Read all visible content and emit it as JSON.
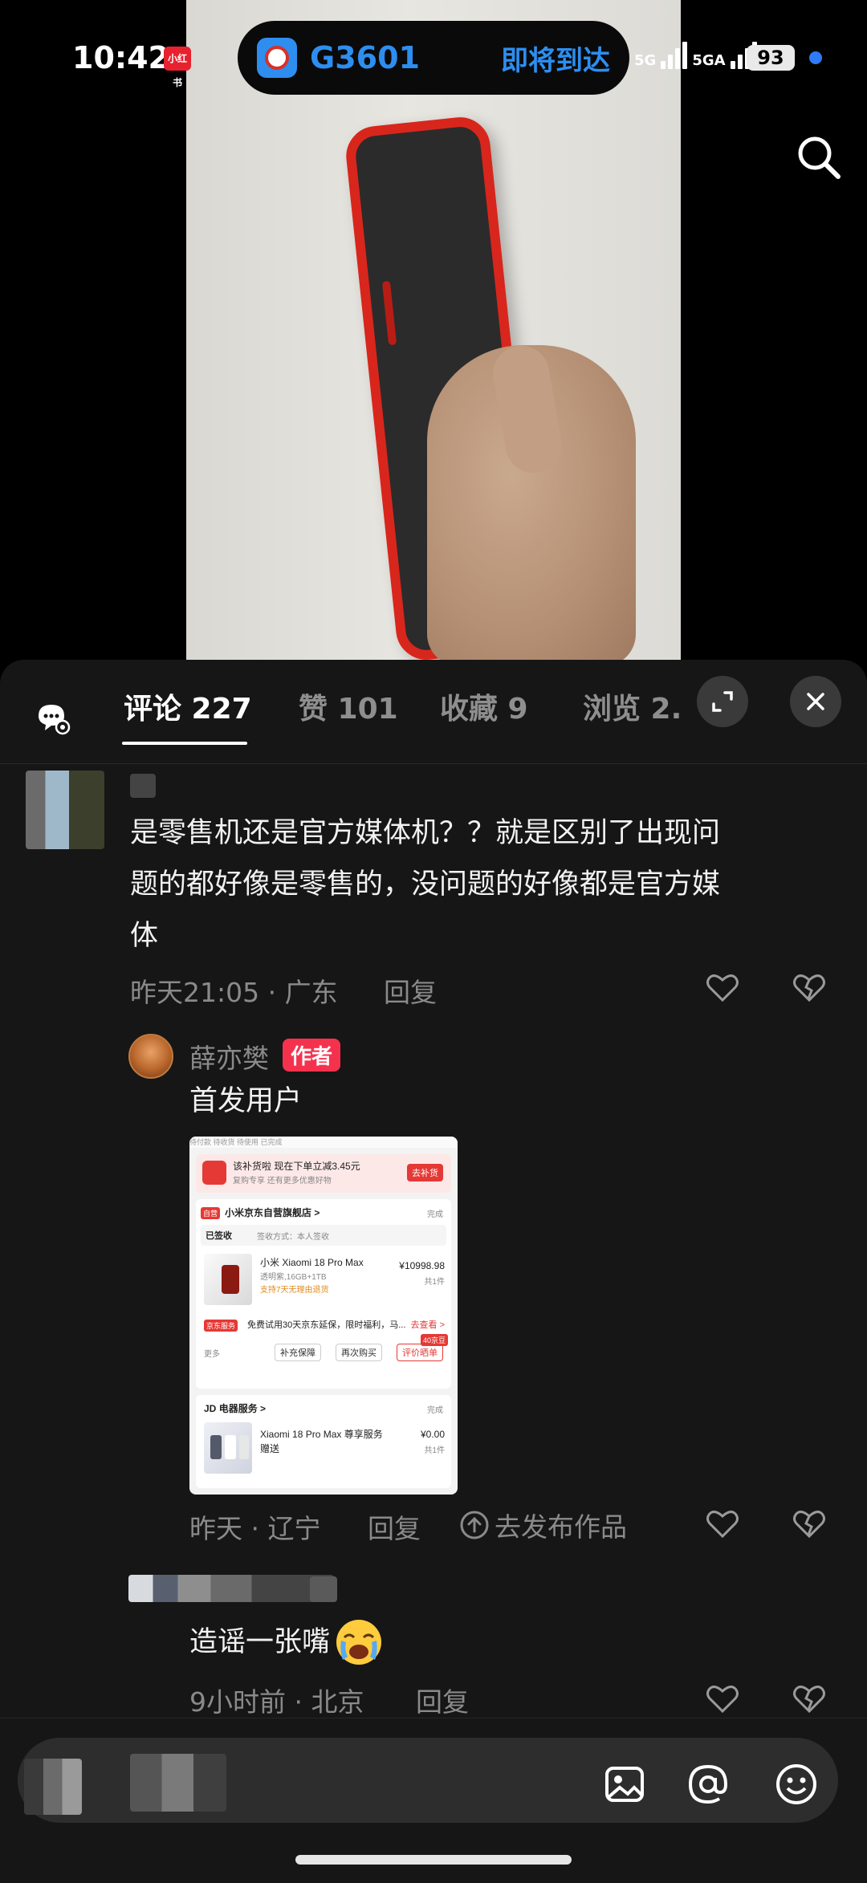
{
  "status_bar": {
    "time": "10:42",
    "app_badge": "小红书",
    "train_number": "G3601",
    "train_status": "即将到达",
    "signal1_label": "5G",
    "signal2_label": "5GA",
    "battery": "93"
  },
  "tabs": [
    {
      "label": "评论 227"
    },
    {
      "label": "赞 101"
    },
    {
      "label": "收藏 9"
    },
    {
      "label": "浏览 2."
    }
  ],
  "comments": [
    {
      "text_line1": "是零售机还是官方媒体机？？就是区别了出现问",
      "text_line2": "题的都好像是零售的，没问题的好像都是官方媒",
      "text_line3": "体",
      "time": "昨天21:05",
      "location": "广东",
      "reply_label": "回复"
    },
    {
      "author": "薛亦樊",
      "badge": "作者",
      "text": "首发用户",
      "time": "昨天",
      "location": "辽宁",
      "reply_label": "回复",
      "publish_label": "去发布作品"
    },
    {
      "text": "造谣一张嘴",
      "time": "9小时前",
      "location": "北京",
      "reply_label": "回复"
    }
  ],
  "screenshot_card": {
    "banner_line1": "该补货啦 现在下单立减3.45元",
    "banner_line2": "复购专享 还有更多优惠好物",
    "banner_button": "去补货",
    "store_tag": "自营",
    "store_name": "小米京东自营旗舰店 >",
    "store_status": "完成",
    "signed_label": "已签收",
    "signed_detail": "签收方式：本人签收",
    "product_name": "小米 Xiaomi 18 Pro Max",
    "product_spec": "透明紫,16GB+1TB",
    "product_note": "支持7天无理由退货",
    "product_price": "¥10998.98",
    "product_count": "共1件",
    "jd_service_tag": "京东服务",
    "jd_service_text": "免费试用30天京东延保，限时福利，马...",
    "jd_service_link": "去查看 >",
    "more_label": "更多",
    "btn1": "补充保障",
    "btn2": "再次购买",
    "btn3": "评价晒单",
    "btn3_tag": "40京豆",
    "service_store": "电器服务 >",
    "service_status": "完成",
    "service_name": "Xiaomi 18 Pro Max 尊享服务",
    "service_name2": "赠送",
    "service_price": "¥0.00",
    "service_count": "共1件",
    "tabs_strip": "待付款  待收货  待使用  已完成"
  },
  "colors": {
    "accent_blue": "#2d8ef0",
    "author_badge": "#f5324e",
    "sheet_bg": "#161616"
  }
}
